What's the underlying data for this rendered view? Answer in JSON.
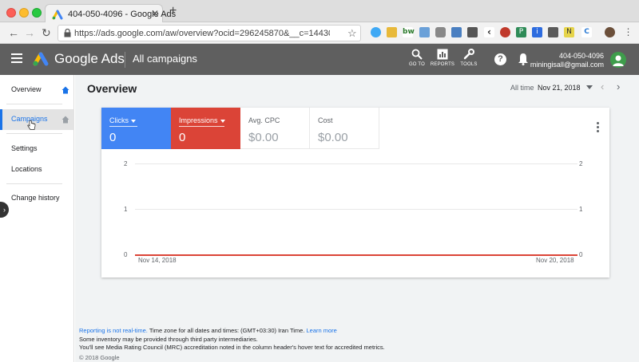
{
  "browser": {
    "tab_title": "404-050-4096 - Google Ads",
    "url": "https://ads.google.com/aw/overview?ocid=296245870&__c=1443093630&aut..."
  },
  "header": {
    "brand": "Google Ads",
    "section": "All campaigns",
    "tools": [
      {
        "label": "GO TO",
        "icon": "search-icon"
      },
      {
        "label": "REPORTS",
        "icon": "reports-icon"
      },
      {
        "label": "TOOLS",
        "icon": "wrench-icon"
      }
    ],
    "help_glyph": "?",
    "account_phone": "404-050-4096",
    "account_email": "miningisall@gmail.com",
    "header_bg": "#5f5f5f"
  },
  "sidebar": {
    "items": [
      {
        "label": "Overview"
      },
      {
        "label": "Campaigns"
      },
      {
        "label": "Settings"
      },
      {
        "label": "Locations"
      },
      {
        "label": "Change history"
      }
    ],
    "active_color": "#1a73e8"
  },
  "overview": {
    "title": "Overview",
    "range_label": "All time",
    "range_date": "Nov 21, 2018"
  },
  "metrics": [
    {
      "label": "Clicks",
      "value": "0",
      "color": "#4285f4"
    },
    {
      "label": "Impressions",
      "value": "0",
      "color": "#db4437"
    },
    {
      "label": "Avg. CPC",
      "value": "$0.00"
    },
    {
      "label": "Cost",
      "value": "$0.00"
    }
  ],
  "chart_data": {
    "type": "line",
    "x": [
      "Nov 14, 2018",
      "Nov 20, 2018"
    ],
    "series": [
      {
        "name": "Clicks",
        "values": [
          0,
          0
        ],
        "color": "#4285f4"
      },
      {
        "name": "Impressions",
        "values": [
          0,
          0
        ],
        "color": "#db4437"
      }
    ],
    "y_ticks_left": [
      "2",
      "1",
      "0"
    ],
    "y_ticks_right": [
      "2",
      "1",
      "0"
    ],
    "ylim": [
      0,
      2
    ],
    "grid": true
  },
  "footer": {
    "link_realtime": "Reporting is not real-time.",
    "timezone_text": " Time zone for all dates and times: (GMT+03:30) Iran Time. ",
    "link_learn": "Learn more",
    "line2": "Some inventory may be provided through third party intermediaries.",
    "line3": "You'll see Media Rating Council (MRC) accreditation noted in the column header's hover text for accredited metrics.",
    "copyright": "© 2018 Google"
  }
}
